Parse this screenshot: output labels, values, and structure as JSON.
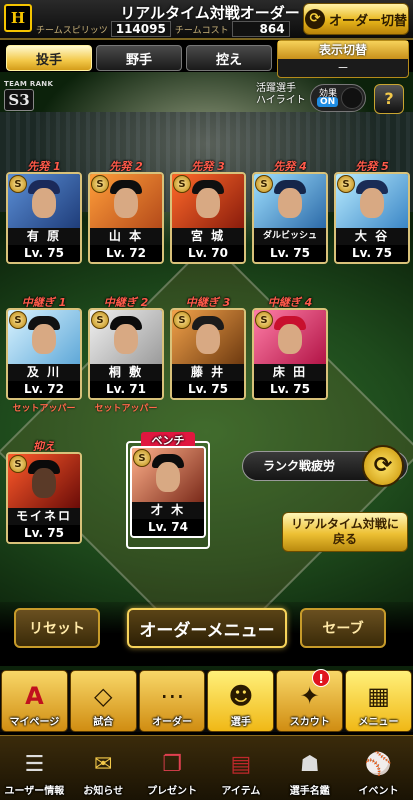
{
  "header": {
    "logo_text": "H",
    "title": "リアルタイム対戦オーダー",
    "team_spirit_label": "チームスピリッツ",
    "team_spirit_value": "114095",
    "team_cost_label": "チームコスト",
    "team_cost_value": "864",
    "order_switch_label": "オーダー切替"
  },
  "tabs": [
    {
      "label": "投手",
      "active": true
    },
    {
      "label": "野手",
      "active": false
    },
    {
      "label": "控え",
      "active": false
    }
  ],
  "display_switch": {
    "label": "表示切替",
    "value": "－"
  },
  "team_rank": {
    "label": "TEAM RANK",
    "value": "S3"
  },
  "highlight": {
    "line1": "活躍選手",
    "line2": "ハイライト"
  },
  "effect_toggle": {
    "label": "効果",
    "state": "ON"
  },
  "help_icon": "?",
  "players": {
    "starters": [
      {
        "role": "先発 1",
        "name": "有 原",
        "level": "Lv. 75"
      },
      {
        "role": "先発 2",
        "name": "山 本",
        "level": "Lv. 72"
      },
      {
        "role": "先発 3",
        "name": "宮 城",
        "level": "Lv. 70"
      },
      {
        "role": "先発 4",
        "name": "ダルビッシュ",
        "level": "Lv. 75"
      },
      {
        "role": "先発 5",
        "name": "大 谷",
        "level": "Lv. 75"
      }
    ],
    "relievers": [
      {
        "role": "中継ぎ 1",
        "name": "及 川",
        "level": "Lv. 72",
        "sub": "セットアッパー"
      },
      {
        "role": "中継ぎ 2",
        "name": "桐 敷",
        "level": "Lv. 71",
        "sub": "セットアッパー"
      },
      {
        "role": "中継ぎ 3",
        "name": "藤 井",
        "level": "Lv. 75"
      },
      {
        "role": "中継ぎ 4",
        "name": "床 田",
        "level": "Lv. 75"
      }
    ],
    "closer": {
      "role": "抑え",
      "name": "モイネロ",
      "level": "Lv. 75"
    },
    "bench": {
      "role": "ベンチ",
      "name": "才 木",
      "level": "Lv. 74"
    }
  },
  "card_rank_glyph": "S",
  "fatigue_button": "ランク戦疲労",
  "realtime_back_button": {
    "line1": "リアルタイム対戦に",
    "line2": "戻る"
  },
  "actions": {
    "reset": "リセット",
    "menu": "オーダーメニュー",
    "save": "セーブ"
  },
  "nav_primary": [
    {
      "icon": "A",
      "label": "マイページ"
    },
    {
      "icon": "◇",
      "label": "試合"
    },
    {
      "icon": "⋯",
      "label": "オーダー"
    },
    {
      "icon": "☻",
      "label": "選手"
    },
    {
      "icon": "✦",
      "label": "スカウト",
      "badge": "!"
    },
    {
      "icon": "▦",
      "label": "メニュー"
    }
  ],
  "nav_secondary": [
    {
      "icon": "☰",
      "label": "ユーザー情報"
    },
    {
      "icon": "✉",
      "label": "お知らせ"
    },
    {
      "icon": "❐",
      "label": "プレゼント"
    },
    {
      "icon": "▤",
      "label": "アイテム"
    },
    {
      "icon": "☗",
      "label": "選手名鑑"
    },
    {
      "icon": "⚾",
      "label": "イベント"
    }
  ],
  "colors": {
    "gold": "#f3c94a",
    "role_red": "#ff5a4a",
    "bench_red": "#e0173f",
    "effect_on_blue": "#1f8de3"
  }
}
